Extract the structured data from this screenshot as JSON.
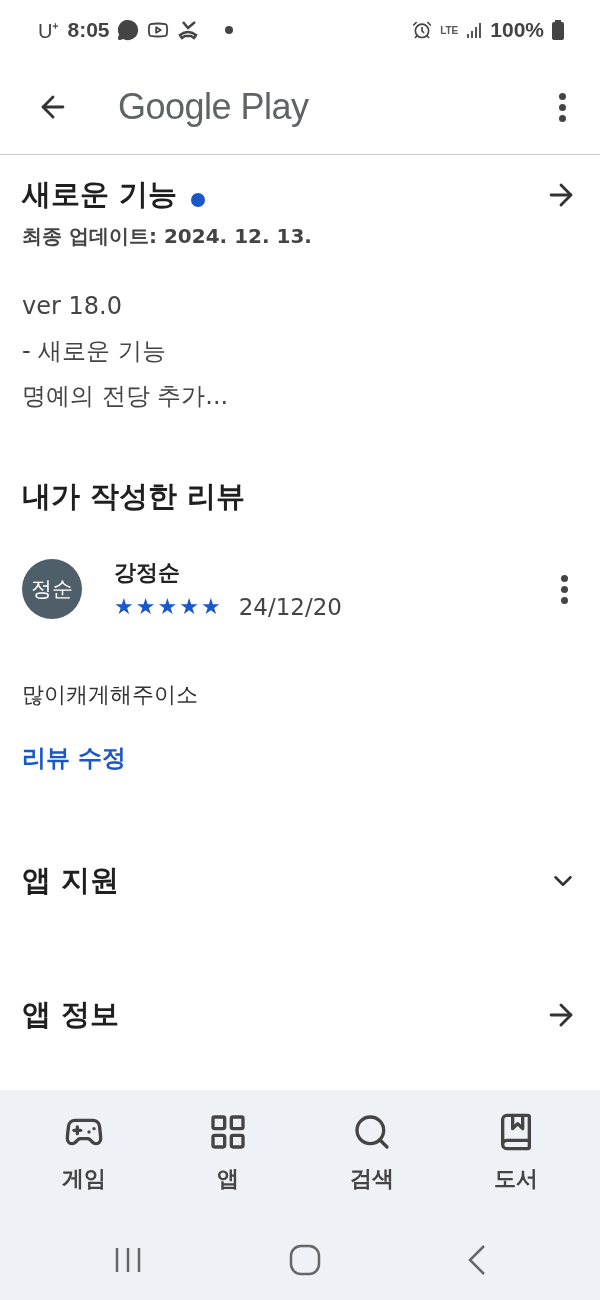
{
  "status_bar": {
    "carrier": "U⁺",
    "time": "8:05",
    "network": "LTE",
    "battery": "100%"
  },
  "app_bar": {
    "title": "Google Play"
  },
  "whats_new": {
    "title": "새로운 기능",
    "has_update": true,
    "updated": "최종 업데이트: 2024. 12. 13.",
    "lines": [
      "ver 18.0",
      "- 새로운 기능",
      "명예의 전당 추가..."
    ]
  },
  "my_review": {
    "title": "내가 작성한 리뷰",
    "avatar": "정순",
    "author": "강정순",
    "stars": 5,
    "date": "24/12/20",
    "text": "많이캐게해주이소",
    "edit_link": "리뷰 수정"
  },
  "app_support": {
    "title": "앱 지원",
    "expanded": false
  },
  "app_info": {
    "title": "앱 정보"
  },
  "bottom_nav": [
    {
      "kind": "games",
      "label": "게임",
      "selected": false
    },
    {
      "kind": "apps",
      "label": "앱",
      "selected": false
    },
    {
      "kind": "search",
      "label": "검색",
      "selected": false
    },
    {
      "kind": "books",
      "label": "도서",
      "selected": false
    }
  ]
}
